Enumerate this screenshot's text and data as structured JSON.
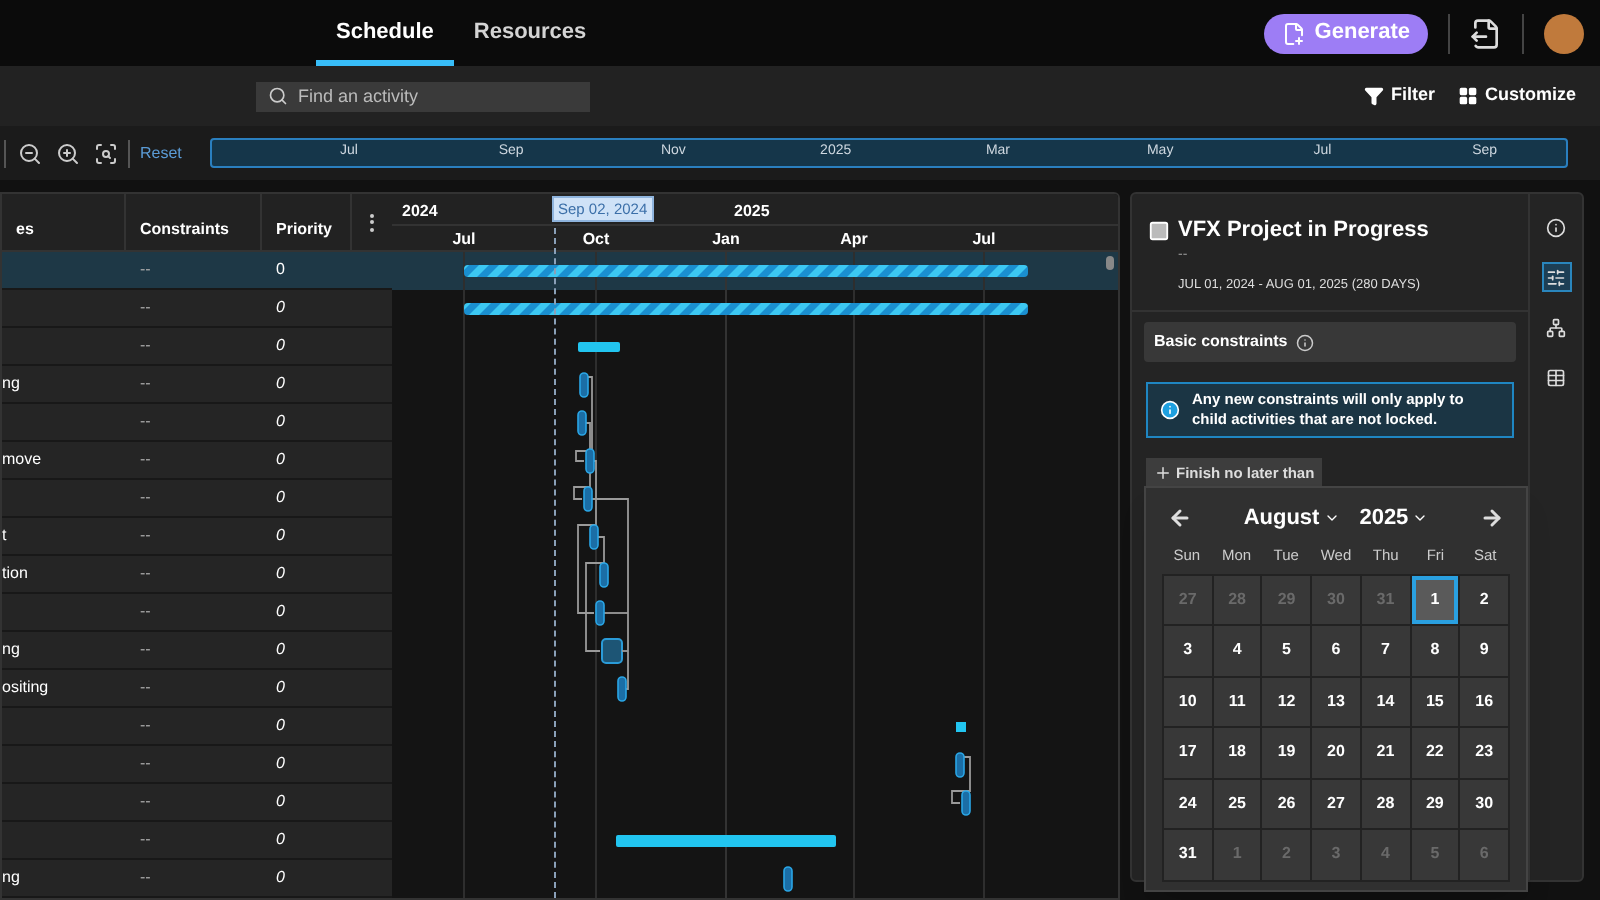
{
  "top_bar": {
    "tabs": [
      {
        "label": "Schedule",
        "selected": true
      },
      {
        "label": "Resources",
        "selected": false
      }
    ],
    "generate_button": "Generate"
  },
  "toolbar": {
    "search": {
      "placeholder": "Find an activity"
    },
    "filter": "Filter",
    "customize": "Customize"
  },
  "zoom_bar": {
    "reset": "Reset",
    "overview_labels": [
      "Jul",
      "Sep",
      "Nov",
      "2025",
      "Mar",
      "May",
      "Jul",
      "Sep"
    ]
  },
  "table": {
    "columns": [
      "es",
      "Constraints",
      "Priority"
    ],
    "rows": [
      {
        "constraints": "--",
        "priority": "0",
        "selected": true
      },
      {
        "constraints": "--",
        "priority": "0",
        "selected": false
      },
      {
        "constraints": "--",
        "priority": "0",
        "selected": false
      },
      {
        "name": "ng",
        "constraints": "--",
        "priority": "0",
        "selected": false
      },
      {
        "constraints": "--",
        "priority": "0",
        "selected": false
      },
      {
        "name": "move",
        "constraints": "--",
        "priority": "0",
        "selected": false
      },
      {
        "constraints": "--",
        "priority": "0",
        "selected": false
      },
      {
        "name": "t",
        "constraints": "--",
        "priority": "0",
        "selected": false
      },
      {
        "name": "tion",
        "constraints": "--",
        "priority": "0",
        "selected": false
      },
      {
        "constraints": "--",
        "priority": "0",
        "selected": false
      },
      {
        "name": "ng",
        "constraints": "--",
        "priority": "0",
        "selected": false
      },
      {
        "name": "ositing",
        "constraints": "--",
        "priority": "0",
        "selected": false
      },
      {
        "constraints": "--",
        "priority": "0",
        "selected": false
      },
      {
        "constraints": "--",
        "priority": "0",
        "selected": false
      },
      {
        "constraints": "--",
        "priority": "0",
        "selected": false
      },
      {
        "constraints": "--",
        "priority": "0",
        "selected": false
      },
      {
        "name": "ng",
        "constraints": "--",
        "priority": "0",
        "selected": false
      }
    ]
  },
  "gantt": {
    "years": [
      "2024",
      "2025"
    ],
    "today_label": "Sep 02, 2024",
    "months": [
      "Jul",
      "Oct",
      "Jan",
      "Apr",
      "Jul"
    ]
  },
  "panel": {
    "title": "VFX Project in Progress",
    "subtitle": "--",
    "dates": "JUL 01, 2024 - AUG 01, 2025 (280 DAYS)",
    "section": "Basic constraints",
    "notice": "Any new constraints will only apply to child activities that are not locked.",
    "constraint_button": "Finish no later than",
    "calendar": {
      "month": "August",
      "year": "2025",
      "weekdays": [
        "Sun",
        "Mon",
        "Tue",
        "Wed",
        "Thu",
        "Fri",
        "Sat"
      ],
      "days": [
        {
          "day": "27",
          "outside": true,
          "selected": false
        },
        {
          "day": "28",
          "outside": true,
          "selected": false
        },
        {
          "day": "29",
          "outside": true,
          "selected": false
        },
        {
          "day": "30",
          "outside": true,
          "selected": false
        },
        {
          "day": "31",
          "outside": true,
          "selected": false
        },
        {
          "day": "1",
          "outside": false,
          "selected": true
        },
        {
          "day": "2",
          "outside": false,
          "selected": false
        },
        {
          "day": "3",
          "outside": false,
          "selected": false
        },
        {
          "day": "4",
          "outside": false,
          "selected": false
        },
        {
          "day": "5",
          "outside": false,
          "selected": false
        },
        {
          "day": "6",
          "outside": false,
          "selected": false
        },
        {
          "day": "7",
          "outside": false,
          "selected": false
        },
        {
          "day": "8",
          "outside": false,
          "selected": false
        },
        {
          "day": "9",
          "outside": false,
          "selected": false
        },
        {
          "day": "10",
          "outside": false,
          "selected": false
        },
        {
          "day": "11",
          "outside": false,
          "selected": false
        },
        {
          "day": "12",
          "outside": false,
          "selected": false
        },
        {
          "day": "13",
          "outside": false,
          "selected": false
        },
        {
          "day": "14",
          "outside": false,
          "selected": false
        },
        {
          "day": "15",
          "outside": false,
          "selected": false
        },
        {
          "day": "16",
          "outside": false,
          "selected": false
        },
        {
          "day": "17",
          "outside": false,
          "selected": false
        },
        {
          "day": "18",
          "outside": false,
          "selected": false
        },
        {
          "day": "19",
          "outside": false,
          "selected": false
        },
        {
          "day": "20",
          "outside": false,
          "selected": false
        },
        {
          "day": "21",
          "outside": false,
          "selected": false
        },
        {
          "day": "22",
          "outside": false,
          "selected": false
        },
        {
          "day": "23",
          "outside": false,
          "selected": false
        },
        {
          "day": "24",
          "outside": false,
          "selected": false
        },
        {
          "day": "25",
          "outside": false,
          "selected": false
        },
        {
          "day": "26",
          "outside": false,
          "selected": false
        },
        {
          "day": "27",
          "outside": false,
          "selected": false
        },
        {
          "day": "28",
          "outside": false,
          "selected": false
        },
        {
          "day": "29",
          "outside": false,
          "selected": false
        },
        {
          "day": "30",
          "outside": false,
          "selected": false
        },
        {
          "day": "31",
          "outside": false,
          "selected": false
        },
        {
          "day": "1",
          "outside": true,
          "selected": false
        },
        {
          "day": "2",
          "outside": true,
          "selected": false
        },
        {
          "day": "3",
          "outside": true,
          "selected": false
        },
        {
          "day": "4",
          "outside": true,
          "selected": false
        },
        {
          "day": "5",
          "outside": true,
          "selected": false
        },
        {
          "day": "6",
          "outside": true,
          "selected": false
        }
      ]
    },
    "side_tabs": [
      {
        "selected": false
      },
      {
        "selected": true
      },
      {
        "selected": false
      },
      {
        "selected": false
      }
    ]
  }
}
